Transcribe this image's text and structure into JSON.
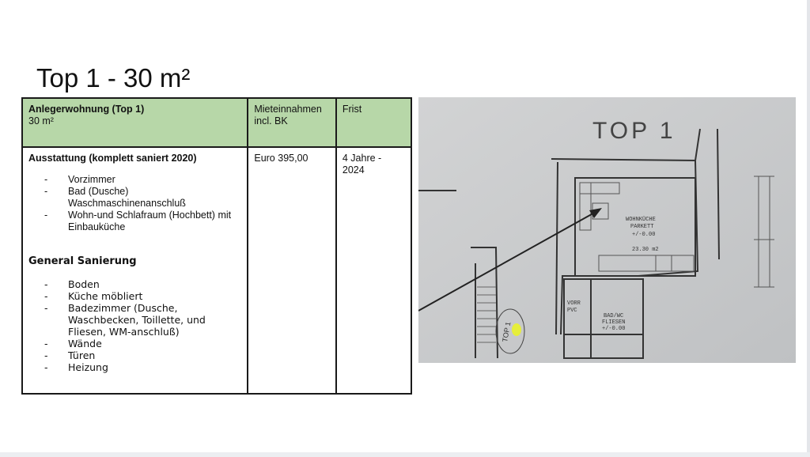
{
  "title": "Top 1 - 30 m²",
  "table": {
    "header": {
      "col1_title": "Anlegerwohnung  (Top 1)",
      "col1_sub": "30 m²",
      "col2": "Mieteinnahmen incl. BK",
      "col3": "Frist"
    },
    "row": {
      "ausstattung_title": "Ausstattung (komplett saniert 2020)",
      "ausstattung_items": [
        "Vorzimmer",
        "Bad (Dusche) Waschmaschinenanschluß",
        "Wohn-und Schlafraum (Hochbett) mit Einbauküche"
      ],
      "sanierung_title": "General Sanierung",
      "sanierung_items": [
        "Boden",
        "Küche möbliert",
        "Badezimmer (Dusche, Waschbecken, Toillette, und Fliesen, WM-anschluß)",
        "Wände",
        "Türen",
        "Heizung"
      ],
      "rent": "Euro 395,00",
      "term": "4 Jahre - 2024"
    }
  },
  "floorplan": {
    "label_top": "TOP 1",
    "room_kitchen": "WOHNKÜCHE",
    "room_kitchen_floor": "PARKETT",
    "room_kitchen_level": "+/-0.00",
    "room_kitchen_area": "23.30 m2",
    "room_hall": "VORR",
    "room_hall_floor": "PVC",
    "room_bath": "BAD/WC",
    "room_bath_floor": "FLIESEN",
    "room_bath_level": "+/-0.00",
    "marker": "TOP 1",
    "highlight_color": "#e6ee3a"
  }
}
